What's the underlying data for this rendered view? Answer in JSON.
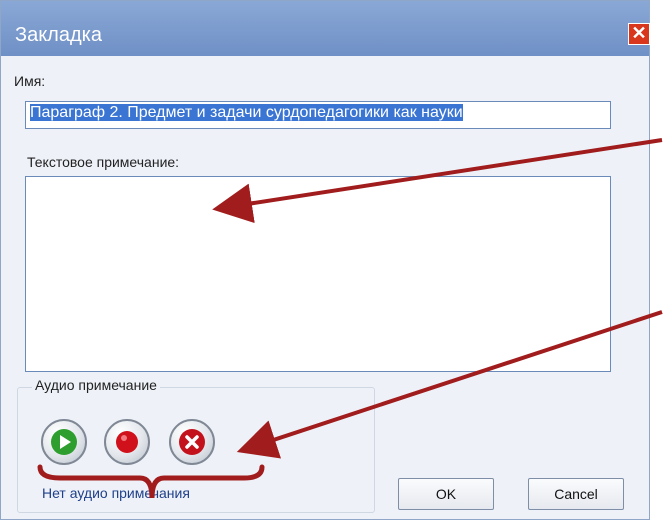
{
  "window": {
    "title": "Закладка",
    "close_symbol": "✕"
  },
  "name": {
    "label": "Имя:",
    "value": "Параграф 2.  Предмет  и задачи сурдопедагогики как науки"
  },
  "note": {
    "label": "Текстовое примечание:",
    "value": ""
  },
  "audio": {
    "group_label": "Аудио примечание",
    "status": "Нет аудио примечания",
    "buttons": [
      {
        "name": "play",
        "icon": "play-icon",
        "color": "#2e9e2e"
      },
      {
        "name": "record",
        "icon": "record-icon",
        "color": "#d0101a"
      },
      {
        "name": "delete",
        "icon": "delete-icon",
        "color": "#c3121b"
      }
    ]
  },
  "buttons": {
    "ok": "OK",
    "cancel": "Cancel"
  },
  "annotation": {
    "color": "#a11d1d"
  }
}
